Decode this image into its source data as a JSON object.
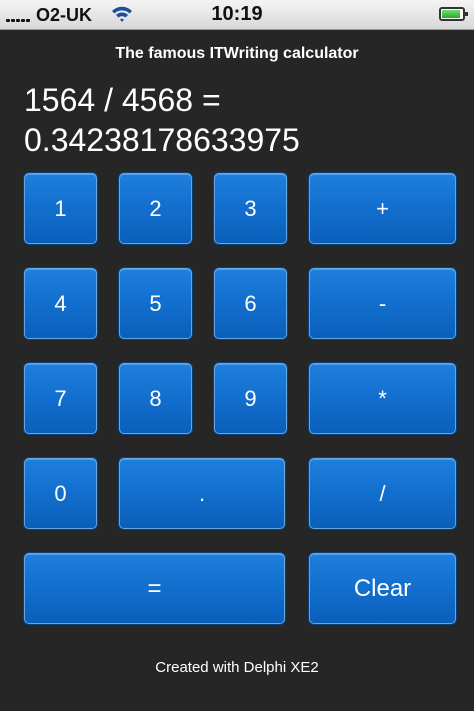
{
  "status_bar": {
    "carrier": "O2-UK",
    "time": "10:19",
    "signal_icon": "signal-bars-icon",
    "wifi_icon": "wifi-icon",
    "battery_icon": "battery-icon"
  },
  "app": {
    "title": "The famous ITWriting calculator",
    "footer": "Created with Delphi XE2"
  },
  "display": {
    "expression": "1564 / 4568 =",
    "result": "0.34238178633975"
  },
  "keys": {
    "k1": "1",
    "k2": "2",
    "k3": "3",
    "plus": "+",
    "k4": "4",
    "k5": "5",
    "k6": "6",
    "minus": "-",
    "k7": "7",
    "k8": "8",
    "k9": "9",
    "multiply": "*",
    "k0": "0",
    "decimal": ".",
    "divide": "/",
    "equals": "=",
    "clear": "Clear"
  },
  "colors": {
    "background": "#262626",
    "key": "#1370cf",
    "key_border": "#5fa8e8",
    "text": "#ffffff"
  }
}
